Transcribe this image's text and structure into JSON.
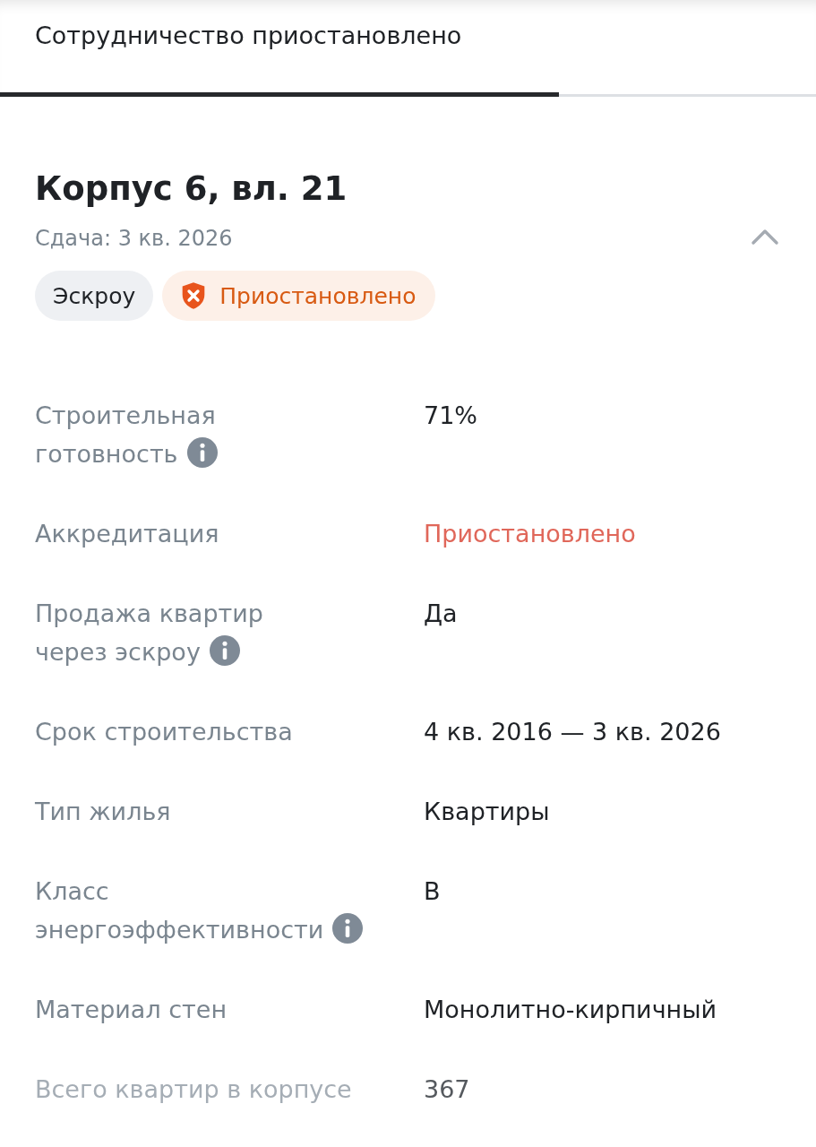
{
  "tabs": [
    {
      "label": "Сотрудничество приостановлено",
      "selected": true
    }
  ],
  "building": {
    "title": "Корпус 6, вл. 21",
    "subtitle": "Сдача: 3 кв. 2026",
    "expanded": true,
    "chips": [
      {
        "label": "Эскроу",
        "kind": "neutral"
      },
      {
        "label": "Приостановлено",
        "kind": "warning"
      }
    ]
  },
  "properties": [
    {
      "label": "Строительная\nготовность",
      "info": true,
      "value": "71%",
      "kind": "normal"
    },
    {
      "label": "Аккредитация",
      "info": false,
      "value": "Приостановлено",
      "kind": "danger"
    },
    {
      "label": "Продажа квартир\nчерез эскроу",
      "info": true,
      "value": "Да",
      "kind": "normal"
    },
    {
      "label": "Срок строительства",
      "info": false,
      "value": "4 кв. 2016 — 3 кв. 2026",
      "kind": "normal"
    },
    {
      "label": "Тип жилья",
      "info": false,
      "value": "Квартиры",
      "kind": "normal"
    },
    {
      "label": "Класс\nэнергоэффективности",
      "info": true,
      "value": "В",
      "kind": "normal"
    },
    {
      "label": "Материал стен",
      "info": false,
      "value": "Монолитно-кирпичный",
      "kind": "normal"
    },
    {
      "label": "Всего квартир в корпусе",
      "info": false,
      "value": "367",
      "kind": "normal"
    }
  ]
}
